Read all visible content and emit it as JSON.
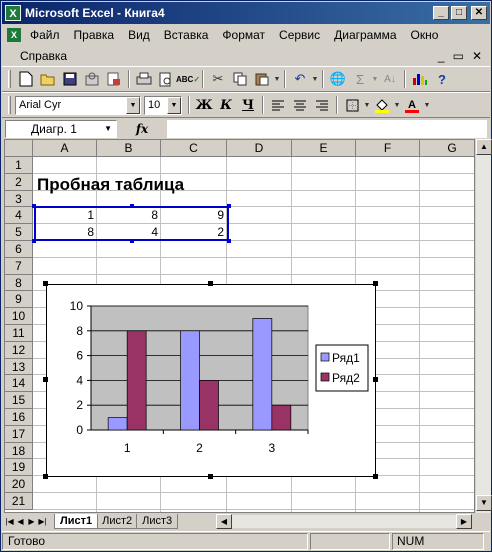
{
  "window": {
    "title": "Microsoft Excel - Книга4",
    "app_icon": "excel-icon",
    "caption_buttons": [
      "_",
      "□",
      "✕"
    ]
  },
  "menu": {
    "items_row1": [
      "Файл",
      "Правка",
      "Вид",
      "Вставка",
      "Формат",
      "Сервис",
      "Диаграмма",
      "Окно"
    ],
    "items_row2": [
      "Справка"
    ],
    "mdi_buttons": [
      "_",
      "▭",
      "✕"
    ]
  },
  "toolbar_standard": {
    "icons": [
      "new-icon",
      "open-icon",
      "save-icon",
      "permission-icon",
      "email-icon",
      "print-icon",
      "preview-icon",
      "spelling-icon",
      "cut-icon",
      "copy-icon",
      "paste-icon",
      "undo-icon",
      "hyperlink-icon",
      "autosum-icon",
      "sort-icon",
      "chart-wizard-icon",
      "help-icon"
    ]
  },
  "toolbar_format": {
    "font": "Arial Cyr",
    "size": "10",
    "bold": "Ж",
    "italic": "К",
    "underline": "Ч",
    "icons": [
      "align-left-icon",
      "align-center-icon",
      "align-right-icon",
      "borders-icon",
      "fill-color-icon",
      "font-color-icon"
    ],
    "fill_color": "#ffff00",
    "font_color": "#ff0000"
  },
  "formula_bar": {
    "name_box": "Диагр. 1",
    "fx_label": "fx",
    "formula": ""
  },
  "grid": {
    "columns": [
      "A",
      "B",
      "C",
      "D",
      "E",
      "F",
      "G"
    ],
    "rows": [
      "1",
      "2",
      "3",
      "4",
      "5",
      "6",
      "7",
      "8",
      "9",
      "10",
      "11",
      "12",
      "13",
      "14",
      "15",
      "16",
      "17",
      "18",
      "19",
      "20",
      "21"
    ],
    "title_cell": "Пробная таблица",
    "row4": [
      "1",
      "8",
      "9"
    ],
    "row5": [
      "8",
      "4",
      "2"
    ]
  },
  "sheets": {
    "tabs": [
      "Лист1",
      "Лист2",
      "Лист3"
    ],
    "active": "Лист1"
  },
  "status": {
    "text": "Готово",
    "num": "NUM"
  },
  "chart_data": {
    "type": "bar",
    "categories": [
      "1",
      "2",
      "3"
    ],
    "series": [
      {
        "name": "Ряд1",
        "values": [
          1,
          8,
          9
        ],
        "color": "#9999ff"
      },
      {
        "name": "Ряд2",
        "values": [
          8,
          4,
          2
        ],
        "color": "#993366"
      }
    ],
    "ylim": [
      0,
      10
    ],
    "yticks": [
      "0",
      "2",
      "4",
      "6",
      "8",
      "10"
    ],
    "grid": true,
    "plot_background": "#c0c0c0",
    "legend": "right"
  }
}
